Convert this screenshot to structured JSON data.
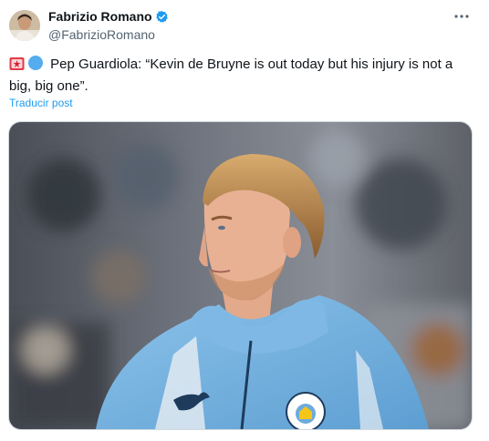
{
  "author": {
    "display_name": "Fabrizio Romano",
    "handle": "@FabrizioRomano",
    "verified": true
  },
  "tweet": {
    "emoji": [
      "red-siren-emoji",
      "light-blue-circle-emoji"
    ],
    "text": "Pep Guardiola: “Kevin de Bruyne is out today but his injury is not a big, big one”.",
    "translate_label": "Traducir post"
  },
  "media": {
    "kind": "photo",
    "jacket_logo_text": "MANCHESTER CITY"
  },
  "colors": {
    "link": "#1d9bf0",
    "verified": "#1d9bf0",
    "secondary_text": "#536471"
  }
}
